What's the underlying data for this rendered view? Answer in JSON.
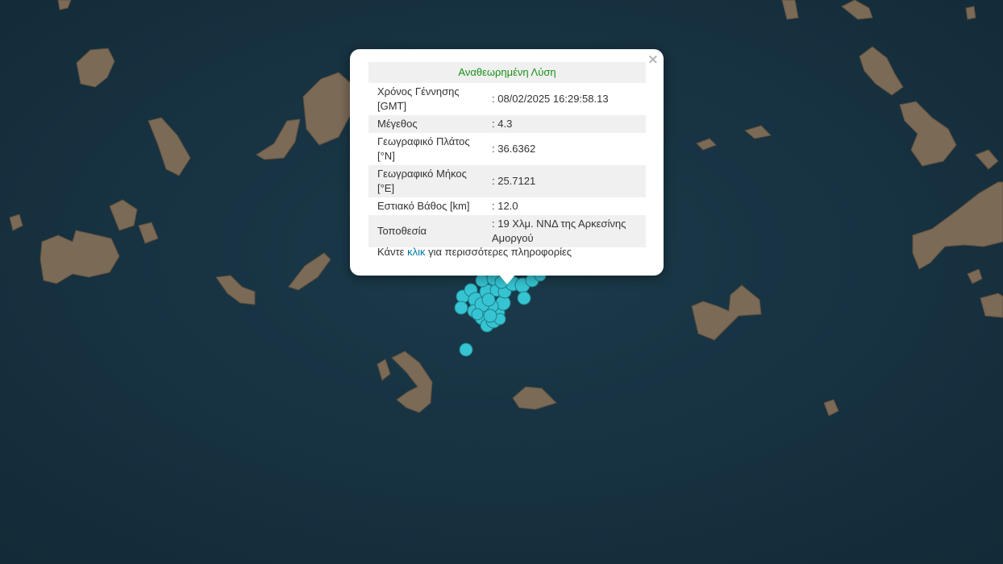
{
  "map": {
    "sea_color": "#17303f",
    "land_color": "#7a6a56",
    "marker_color": "#36c4d2",
    "features": [
      "islands",
      "earthquake-epicenters"
    ]
  },
  "popup": {
    "close_icon": "×",
    "title": "Αναθεωρημένη Λύση",
    "rows": [
      {
        "label": "Χρόνος Γέννησης [GMT]",
        "value": ": 08/02/2025 16:29:58.13"
      },
      {
        "label": "Μέγεθος",
        "value": ": 4.3"
      },
      {
        "label": "Γεωγραφικό Πλάτος [°N]",
        "value": ": 36.6362"
      },
      {
        "label": "Γεωγραφικό Μήκος [°E]",
        "value": ": 25.7121"
      },
      {
        "label": "Εστιακό Βάθος [km]",
        "value": ": 12.0"
      },
      {
        "label": "Τοποθεσία",
        "value": ": 19 Χλμ. ΝΝΔ της Αρκεσίνης Αμοργού"
      }
    ],
    "footer": {
      "before": "Κάντε ",
      "link": "κλικ",
      "after": " για περισσότερες πληροφορίες"
    }
  }
}
